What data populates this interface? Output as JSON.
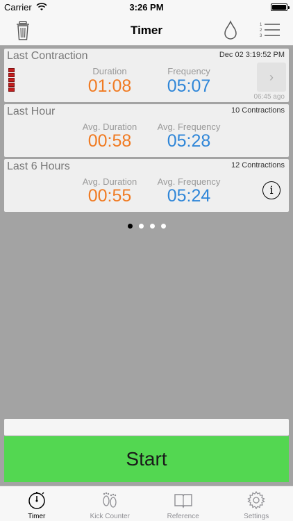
{
  "status": {
    "carrier": "Carrier",
    "time": "3:26 PM"
  },
  "nav": {
    "title": "Timer"
  },
  "last_contraction": {
    "title": "Last Contraction",
    "date": "Dec 02 3:19:52 PM",
    "duration_label": "Duration",
    "duration": "01:08",
    "frequency_label": "Frequency",
    "frequency": "05:07",
    "ago": "06:45 ago",
    "chevron": "›"
  },
  "last_hour": {
    "title": "Last Hour",
    "count": "10 Contractions",
    "duration_label": "Avg. Duration",
    "duration": "00:58",
    "frequency_label": "Avg. Frequency",
    "frequency": "05:28"
  },
  "last_6_hours": {
    "title": "Last 6 Hours",
    "count": "12 Contractions",
    "duration_label": "Avg. Duration",
    "duration": "00:55",
    "frequency_label": "Avg. Frequency",
    "frequency": "05:24",
    "info": "i"
  },
  "start_label": "Start",
  "tabs": [
    {
      "label": "Timer"
    },
    {
      "label": "Kick Counter"
    },
    {
      "label": "Reference"
    },
    {
      "label": "Settings"
    }
  ],
  "colors": {
    "duration": "#f07b23",
    "frequency": "#2f86d8",
    "start": "#53d751"
  }
}
